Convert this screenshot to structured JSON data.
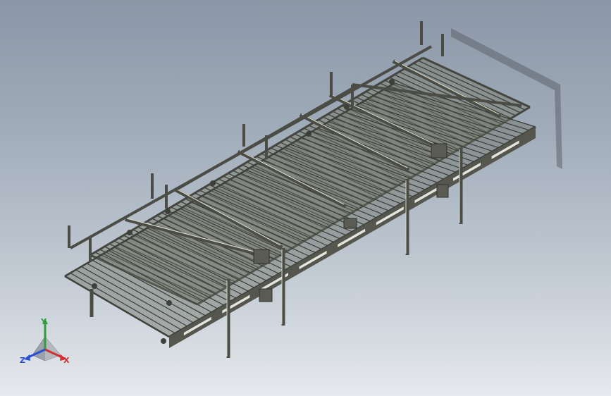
{
  "viewport": {
    "background_top": "#8b97a6",
    "background_bottom": "#e6e9ed",
    "model_color": "#5d6055",
    "model_highlight": "#c9ccbc"
  },
  "triad": {
    "x_label": "X",
    "y_label": "Y",
    "z_label": "Z",
    "x_color": "#d23030",
    "y_color": "#2f9e3a",
    "z_color": "#2a4ed6"
  }
}
